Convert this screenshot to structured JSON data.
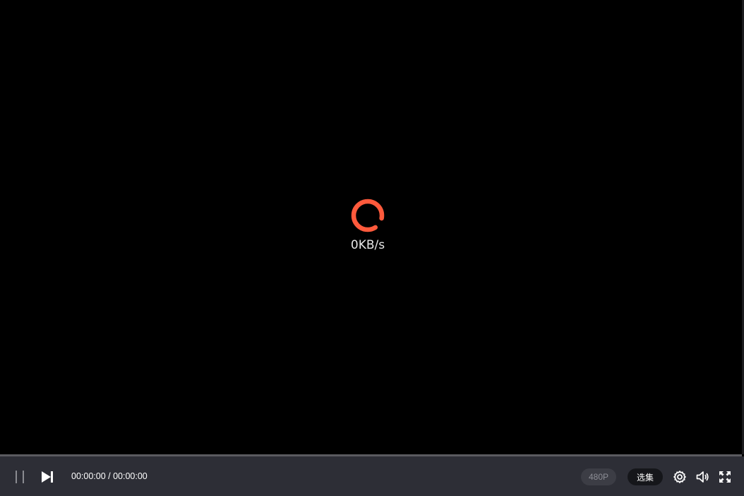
{
  "loader": {
    "speed": "0KB/s",
    "color": "#ff5a3c"
  },
  "controls": {
    "pause_icon": "pause-icon",
    "next_icon": "next-icon",
    "time": "00:00:00 / 00:00:00",
    "quality": "480P",
    "episodes": "选集",
    "settings_icon": "gear-icon",
    "volume_icon": "volume-icon",
    "fullscreen_icon": "fullscreen-icon"
  }
}
